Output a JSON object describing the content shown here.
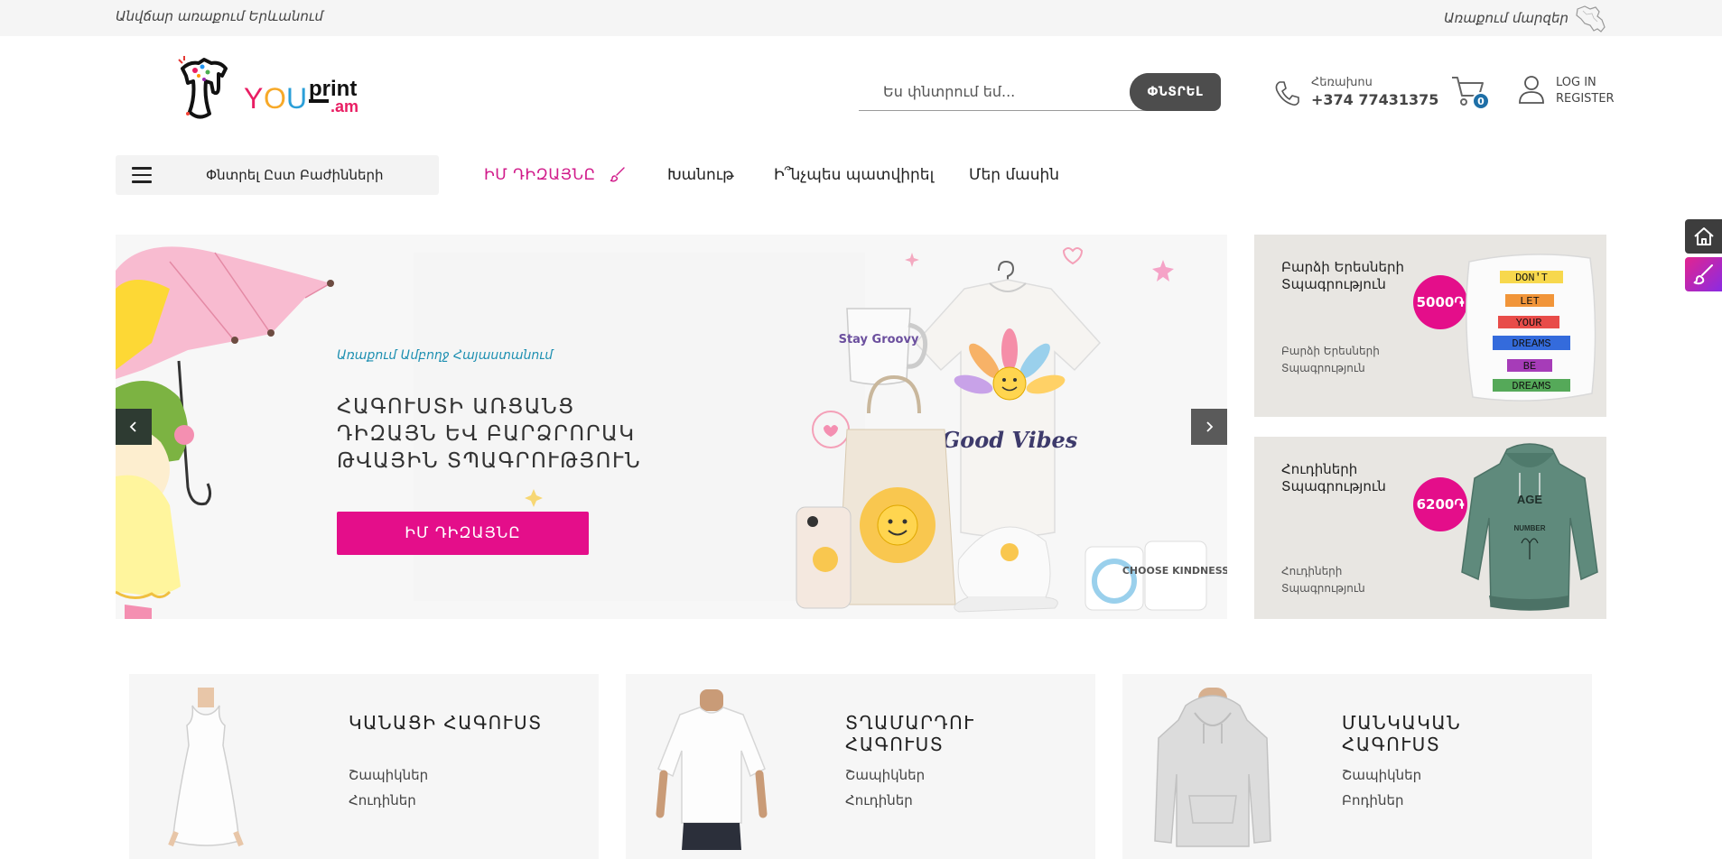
{
  "topbar": {
    "free_delivery": "Անվճար առաքում Երևանում",
    "delivery_regions": "Առաքում մարզեր"
  },
  "logo": {
    "text_you": "YOU",
    "text_print": "print",
    "text_am": ".am"
  },
  "search": {
    "placeholder": "Ես փնտրում եմ...",
    "button_label": "ՓՆՏՐԵԼ"
  },
  "contact": {
    "label": "Հեռախոս",
    "phone": "+374 77431375"
  },
  "cart": {
    "count": "0"
  },
  "account": {
    "login": "LOG IN",
    "register": "REGISTER"
  },
  "nav": {
    "categories_label": "Փնտրել Ըստ Բաժինների",
    "items": [
      {
        "label": "ԻՄ ԴԻԶԱՅՆԸ"
      },
      {
        "label": "Խանութ"
      },
      {
        "label": "Ի՞նչպես պատվիրել"
      },
      {
        "label": "Մեր մասին"
      }
    ]
  },
  "hero": {
    "kicker": "Առաքում Ամբողջ Հայաստանում",
    "headline": "ՀԱԳՈՒՍՏԻ ԱՌՑԱՆՑ ԴԻԶԱՅՆ ԵՎ ԲԱՐՁՐՈՐԱԿ ԹՎԱՅԻՆ ՏՊԱԳՐՈՒԹՅՈՒՆ",
    "cta": "ԻՄ ԴԻԶԱՅՆԸ",
    "mug_text": "Stay Groovy",
    "shirt_text": "Good Vibes",
    "coaster_text": "CHOOSE KINDNESS"
  },
  "promos": [
    {
      "title": "Բարձի Երեսների Տպագրություն",
      "subtitle": "Բարձի Երեսների Տպագրություն",
      "price": "5000֏",
      "image_words": [
        "DON'T",
        "LET",
        "YOUR",
        "DREAMS",
        "BE",
        "DREAMS"
      ]
    },
    {
      "title": "Հուդիների Տպագրություն",
      "subtitle": "Հուդիների Տպագրություն",
      "price": "6200֏",
      "image_words": [
        "AGE",
        "NUMBER"
      ]
    }
  ],
  "categories": [
    {
      "title": "ԿԱՆԱՑԻ ՀԱԳՈՒՍՏ",
      "links": [
        "Շապիկներ",
        "Հուդիներ"
      ]
    },
    {
      "title": "ՏՂԱՄԱՐԴՈՒ ՀԱԳՈՒՍՏ",
      "links": [
        "Շապիկներ",
        "Հուդիներ"
      ]
    },
    {
      "title": "ՄԱՆԿԱԿԱՆ ՀԱԳՈՒՍՏ",
      "links": [
        "Շապիկներ",
        "Բոդիներ"
      ]
    }
  ],
  "colors": {
    "accent_pink": "#e40e8a",
    "kicker_blue": "#1d8fb1",
    "cart_badge": "#1e6fa7",
    "search_button": "#4d4d4d"
  }
}
